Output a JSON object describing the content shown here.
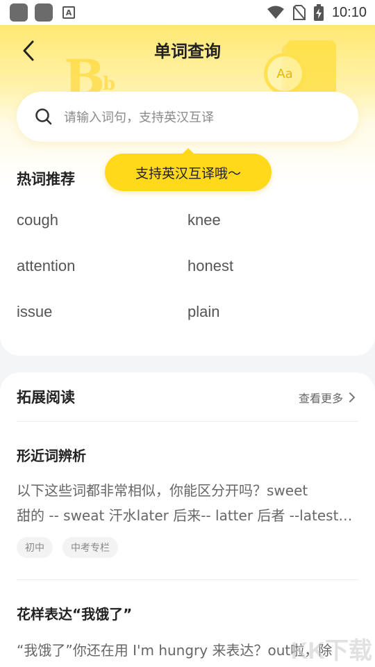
{
  "status_bar": {
    "time": "10:10"
  },
  "header": {
    "title": "单词查询"
  },
  "search": {
    "placeholder": "请输入词句，支持英汉互译"
  },
  "tooltip": {
    "text": "支持英汉互译哦～"
  },
  "hot_words": {
    "title": "热词推荐",
    "words": [
      "cough",
      "knee",
      "attention",
      "honest",
      "issue",
      "plain"
    ]
  },
  "reading": {
    "title": "拓展阅读",
    "more_label": "查看更多",
    "articles": [
      {
        "title": "形近词辨析",
        "excerpt_line1": "以下这些词都非常相似，你能区分开吗？sweet",
        "excerpt_line2": "甜的 -- sweat 汗水later 后来-- latter 后者 --latest…",
        "tags": [
          "初中",
          "中考专栏"
        ]
      },
      {
        "title": "花样表达“我饿了”",
        "excerpt_line1": "“我饿了”你还在用 I'm hungry 来表达？out啦，除"
      }
    ]
  },
  "watermark": "KK下载"
}
